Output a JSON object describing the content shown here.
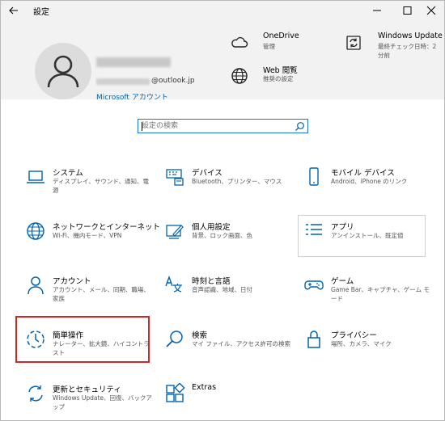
{
  "window": {
    "title": "設定"
  },
  "account": {
    "email_suffix": "@outlook.jp",
    "link_label": "Microsoft アカウント"
  },
  "header_items": {
    "onedrive": {
      "title": "OneDrive",
      "subtitle": "管理"
    },
    "web": {
      "title": "Web 閲覧",
      "subtitle": "推奨の設定"
    },
    "update": {
      "title": "Windows Update",
      "subtitle": "最終チェック日時：2 分前"
    }
  },
  "search": {
    "placeholder": "設定の検索"
  },
  "tiles": [
    {
      "title": "システム",
      "desc": "ディスプレイ、サウンド、通知、電源",
      "icon": "laptop-icon"
    },
    {
      "title": "デバイス",
      "desc": "Bluetooth、プリンター、マウス",
      "icon": "keyboard-printer-icon"
    },
    {
      "title": "モバイル デバイス",
      "desc": "Android、iPhone のリンク",
      "icon": "phone-icon"
    },
    {
      "title": "ネットワークとインターネット",
      "desc": "Wi-Fi、機内モード、VPN",
      "icon": "globe-icon"
    },
    {
      "title": "個人用設定",
      "desc": "背景、ロック画面、色",
      "icon": "personalization-icon"
    },
    {
      "title": "アプリ",
      "desc": "アンインストール、既定値",
      "icon": "apps-list-icon"
    },
    {
      "title": "アカウント",
      "desc": "アカウント、メール、同期、職場、家族",
      "icon": "person-icon"
    },
    {
      "title": "時刻と言語",
      "desc": "音声認識、地域、日付",
      "icon": "time-language-icon"
    },
    {
      "title": "ゲーム",
      "desc": "Game Bar、キャプチャ、ゲーム モード",
      "icon": "gamepad-icon"
    },
    {
      "title": "簡単操作",
      "desc": "ナレーター、拡大鏡、ハイコントラスト",
      "icon": "ease-of-access-icon"
    },
    {
      "title": "検索",
      "desc": "マイ ファイル、アクセス許可の検索",
      "icon": "search-icon"
    },
    {
      "title": "プライバシー",
      "desc": "場所、カメラ、マイク",
      "icon": "lock-icon"
    },
    {
      "title": "更新とセキュリティ",
      "desc": "Windows Update、回復、バックアップ",
      "icon": "sync-icon"
    },
    {
      "title": "Extras",
      "desc": "",
      "icon": "extras-icon"
    }
  ],
  "colors": {
    "accent": "#0063b1",
    "icon": "#0063b1",
    "highlight": "#d42525",
    "header_bg": "#f2f2f2"
  }
}
